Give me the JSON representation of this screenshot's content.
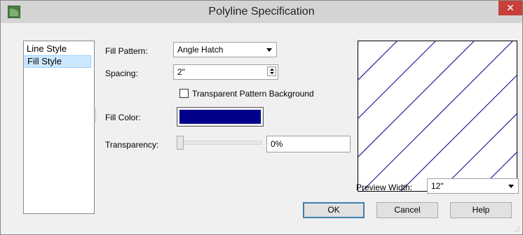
{
  "window": {
    "title": "Polyline Specification",
    "close_label": "✕"
  },
  "sidebar": {
    "items": [
      {
        "label": "Line Style",
        "selected": false
      },
      {
        "label": "Fill Style",
        "selected": true
      }
    ]
  },
  "form": {
    "fill_pattern": {
      "label": "Fill Pattern:",
      "value": "Angle Hatch"
    },
    "spacing": {
      "label": "Spacing:",
      "value": "2\""
    },
    "transparent_background": {
      "label": "Transparent Pattern Background",
      "checked": false
    },
    "fill_color": {
      "label": "Fill Color:",
      "color": "#00008b"
    },
    "transparency": {
      "label": "Transparency:",
      "value": "0%",
      "level": 0
    }
  },
  "preview": {
    "pattern": "angle-hatch",
    "line_color": "#00008b",
    "width_label": "Preview Width:",
    "width_value": "12\""
  },
  "buttons": {
    "ok": "OK",
    "cancel": "Cancel",
    "help": "Help"
  }
}
